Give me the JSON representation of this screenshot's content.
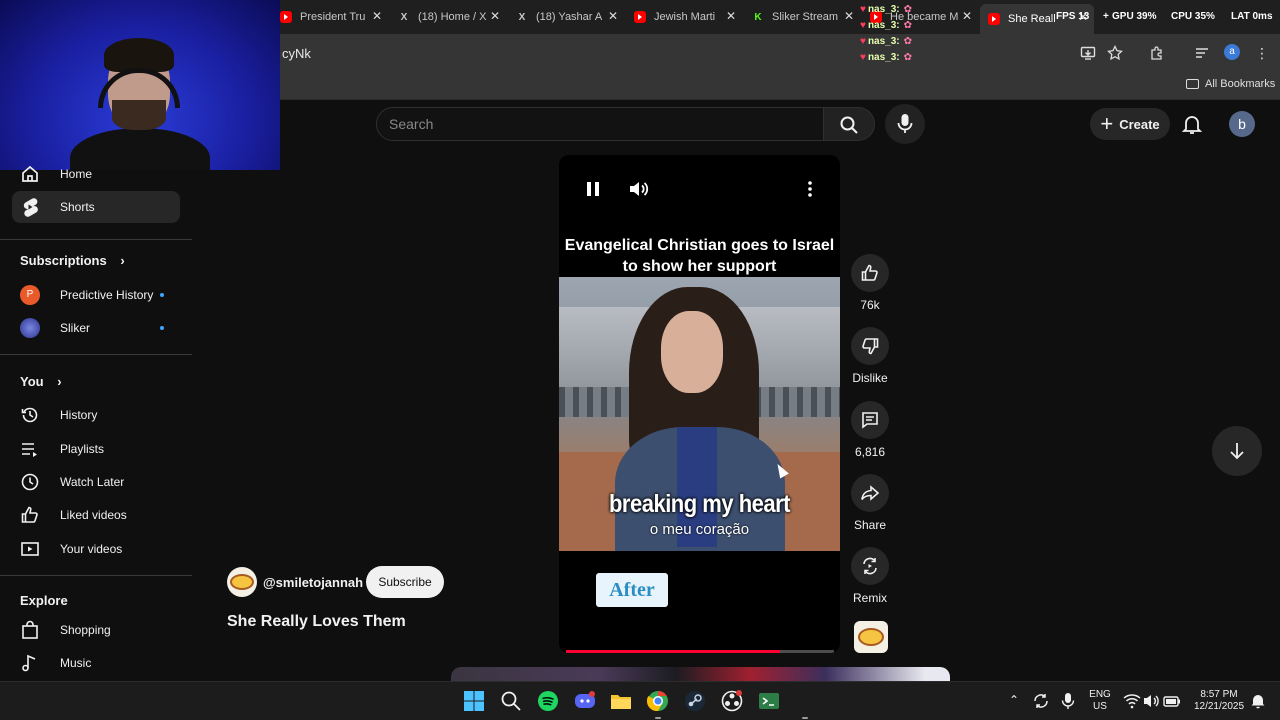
{
  "browser": {
    "tabs": [
      {
        "label": "President Tru",
        "icon": "youtube-icon"
      },
      {
        "label": "(18) Home / X",
        "icon": "x-icon"
      },
      {
        "label": "(18) Yashar A",
        "icon": "x-icon"
      },
      {
        "label": "Jewish Marti",
        "icon": "youtube-icon"
      },
      {
        "label": "Sliker Stream",
        "icon": "kick-icon"
      },
      {
        "label": "He became M",
        "icon": "youtube-icon"
      },
      {
        "label": "She Reall",
        "icon": "youtube-icon"
      }
    ],
    "url_fragment": "cyNk",
    "bookmarks_label": "All Bookmarks",
    "profile_letter": "a",
    "overlay_stats": {
      "fps": "FPS",
      "fps_value": "13",
      "gpu": "GPU",
      "gpu_value": "39%",
      "cpu": "CPU",
      "cpu_value": "35%",
      "lat": "LAT",
      "lat_value": "0ms"
    }
  },
  "chat_overlay": {
    "lines": [
      "nas_3:",
      "nas_3:",
      "nas_3:",
      "nas_3:"
    ]
  },
  "youtube": {
    "search_placeholder": "Search",
    "create_label": "Create",
    "avatar_letter": "b"
  },
  "sidebar": {
    "main": [
      {
        "label": "Home",
        "icon": "home-icon"
      },
      {
        "label": "Shorts",
        "icon": "shorts-icon",
        "active": true
      }
    ],
    "subscriptions_heading": "Subscriptions",
    "subscriptions": [
      {
        "label": "Predictive History",
        "avatar_letter": "P",
        "color": "#e85a2a"
      },
      {
        "label": "Sliker",
        "avatar_letter": "",
        "color": "#4a56a8"
      }
    ],
    "you_heading": "You",
    "you": [
      {
        "label": "History",
        "icon": "history-icon"
      },
      {
        "label": "Playlists",
        "icon": "playlists-icon"
      },
      {
        "label": "Watch Later",
        "icon": "watch-later-icon"
      },
      {
        "label": "Liked videos",
        "icon": "like-icon"
      },
      {
        "label": "Your videos",
        "icon": "your-videos-icon"
      }
    ],
    "explore_heading": "Explore",
    "explore": [
      {
        "label": "Shopping",
        "icon": "shopping-icon"
      },
      {
        "label": "Music",
        "icon": "music-icon"
      }
    ]
  },
  "short": {
    "caption": "Evangelical Christian goes to Israel to show her support",
    "subtitle_en": "breaking my heart",
    "subtitle_pt": "o meu coração",
    "overlay_tag": "After",
    "progress": 0.8
  },
  "actions": {
    "likes": "76k",
    "dislike_label": "Dislike",
    "comments": "6,816",
    "share_label": "Share",
    "remix_label": "Remix"
  },
  "video_meta": {
    "channel": "@smiletojannah",
    "subscribe_label": "Subscribe",
    "title": "She Really Loves Them"
  },
  "taskbar": {
    "lang_line1": "ENG",
    "lang_line2": "US",
    "time": "8:57 PM",
    "date": "12/21/2025"
  }
}
